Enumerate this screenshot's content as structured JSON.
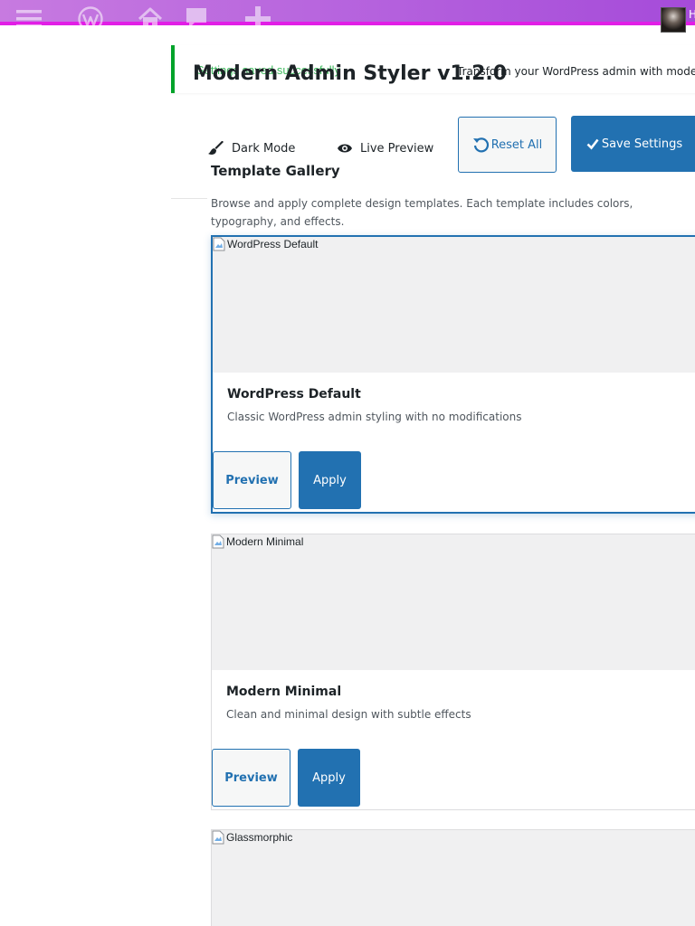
{
  "admin_bar": {
    "icons": [
      "menu-icon",
      "wordpress-logo-icon",
      "home-icon",
      "comment-icon",
      "plus-icon"
    ],
    "user_label": "H"
  },
  "notice": {
    "message": "Settings saved successfully"
  },
  "header": {
    "title": "Modern Admin Styler v1.2.0",
    "subtitle": "Transform your WordPress admin with modern"
  },
  "toolbar": {
    "dark_mode_label": "Dark Mode",
    "live_preview_label": "Live Preview",
    "reset_label": "Reset All",
    "save_label": "Save Settings"
  },
  "gallery": {
    "title": "Template Gallery",
    "description": "Browse and apply complete design templates. Each template includes colors, typography, and effects.",
    "templates": [
      {
        "thumb_alt": "WordPress Default",
        "name": "WordPress Default",
        "description": "Classic WordPress admin styling with no modifications",
        "preview_label": "Preview",
        "apply_label": "Apply",
        "active": true
      },
      {
        "thumb_alt": "Modern Minimal",
        "name": "Modern Minimal",
        "description": "Clean and minimal design with subtle effects",
        "preview_label": "Preview",
        "apply_label": "Apply",
        "active": false
      },
      {
        "thumb_alt": "Glassmorphic",
        "name": "",
        "description": "",
        "preview_label": "",
        "apply_label": "",
        "active": false
      }
    ]
  },
  "colors": {
    "accent": "#2271b1",
    "success": "#00a32a",
    "admin_bar_start": "#c77ae0",
    "admin_bar_end": "#a54bd9",
    "admin_bar_border": "#e11ee6"
  }
}
